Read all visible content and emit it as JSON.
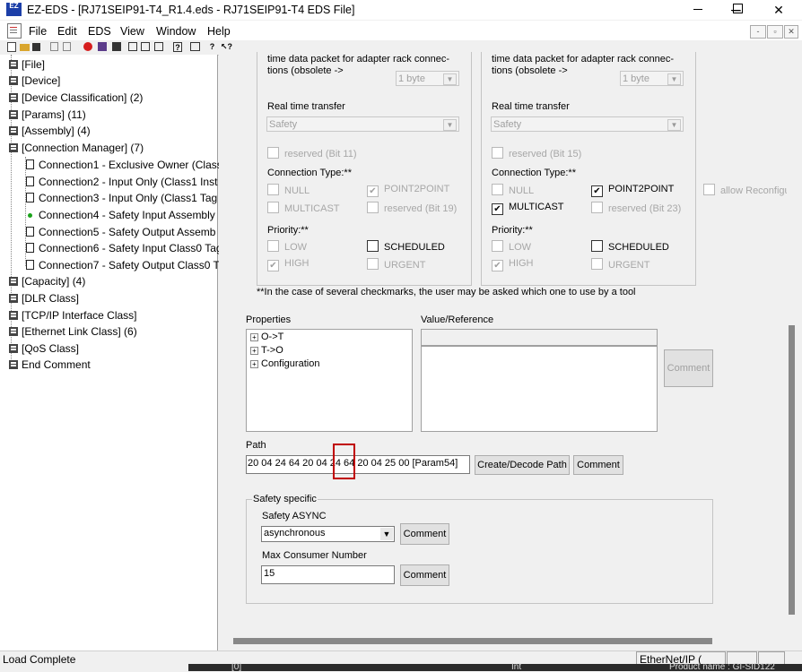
{
  "window": {
    "app_logo": "EZ",
    "title": "EZ-EDS - [RJ71SEIP91-T4_R1.4.eds - RJ71SEIP91-T4 EDS File]",
    "min_glyph": "─",
    "max_glyph": "☐",
    "close_glyph": "✕"
  },
  "menu": {
    "items": [
      "File",
      "Edit",
      "EDS",
      "View",
      "Window",
      "Help"
    ],
    "mdi_min": "-",
    "mdi_restore": "▫",
    "mdi_close": "✕"
  },
  "toolbar": {
    "icons": [
      "new-icon",
      "open-icon",
      "save-icon",
      "copy-icon",
      "paste-icon",
      "stop-icon",
      "library-icon",
      "tree-icon",
      "tree2-icon",
      "tree3-icon",
      "help-icon",
      "print-icon",
      "about-icon",
      "context-help-icon"
    ]
  },
  "tree": {
    "items": [
      {
        "label": "[File]"
      },
      {
        "label": "[Device]"
      },
      {
        "label": "[Device Classification] (2)"
      },
      {
        "label": "[Params] (11)"
      },
      {
        "label": "[Assembly] (4)"
      },
      {
        "label": "[Connection Manager] (7)"
      },
      {
        "label": "Connection1 - Exclusive Owner (Class1"
      },
      {
        "label": "Connection2 - Input Only (Class1 Inst"
      },
      {
        "label": "Connection3 - Input Only (Class1 Tag"
      },
      {
        "label": "Connection4 - Safety Input Assembly"
      },
      {
        "label": "Connection5 - Safety Output Assemb"
      },
      {
        "label": "Connection6 - Safety Input Class0 Tag"
      },
      {
        "label": "Connection7 - Safety Output Class0 T"
      },
      {
        "label": "[Capacity] (4)"
      },
      {
        "label": "[DLR Class]"
      },
      {
        "label": "[TCP/IP Interface Class]"
      },
      {
        "label": "[Ethernet Link Class] (6)"
      },
      {
        "label": "[QoS Class]"
      },
      {
        "label": "End Comment"
      }
    ]
  },
  "left_panel": {
    "header_line1": "time data packet for adapter rack connec-",
    "header_line2": "tions (obsolete ->",
    "byte_value": "1 byte",
    "realtime_label": "Real time transfer",
    "realtime_value": "Safety",
    "reserved_top": "reserved (Bit 11)",
    "conn_type_label": "Connection Type:**",
    "null": "NULL",
    "p2p": "POINT2POINT",
    "multicast": "MULTICAST",
    "reserved_mid": "reserved (Bit 19)",
    "priority_label": "Priority:**",
    "low": "LOW",
    "scheduled": "SCHEDULED",
    "high": "HIGH",
    "urgent": "URGENT"
  },
  "right_panel": {
    "header_line1": "time data packet for adapter rack connec-",
    "header_line2": "tions (obsolete ->",
    "byte_value": "1 byte",
    "realtime_label": "Real time transfer",
    "realtime_value": "Safety",
    "reserved_top": "reserved (Bit 15)",
    "conn_type_label": "Connection Type:**",
    "null": "NULL",
    "p2p": "POINT2POINT",
    "multicast": "MULTICAST",
    "reserved_mid": "reserved (Bit 23)",
    "priority_label": "Priority:**",
    "low": "LOW",
    "scheduled": "SCHEDULED",
    "high": "HIGH",
    "urgent": "URGENT",
    "allow_reconfig": "allow Reconfigu"
  },
  "checkmark": "✔",
  "footnote": "**In the case of several checkmarks, the user may be asked which one to use by a tool",
  "properties": {
    "label": "Properties",
    "value_label": "Value/Reference",
    "items": [
      "O->T",
      "T->O",
      "Configuration"
    ],
    "comment_button": "Comment"
  },
  "path": {
    "label": "Path",
    "value": "20 04 24 64 20 04 24 64 20 04 25 00 [Param54]",
    "decode_button": "Create/Decode Path",
    "comment_button": "Comment"
  },
  "safety": {
    "group_label": "Safety specific",
    "async_label": "Safety ASYNC",
    "async_value": "asynchronous",
    "async_comment": "Comment",
    "consumer_label": "Max Consumer Number",
    "consumer_value": "15",
    "consumer_comment": "Comment"
  },
  "status": {
    "text": "Load Complete",
    "protocol": "EtherNet/IP (",
    "behind_1": "[0]",
    "behind_2": "Int",
    "behind_3": "Product name : GI-SID122"
  },
  "colors": {
    "highlight_box": "#c00000",
    "tree_dot": "#1aa31a",
    "logo_bg": "#1c3fa8"
  }
}
